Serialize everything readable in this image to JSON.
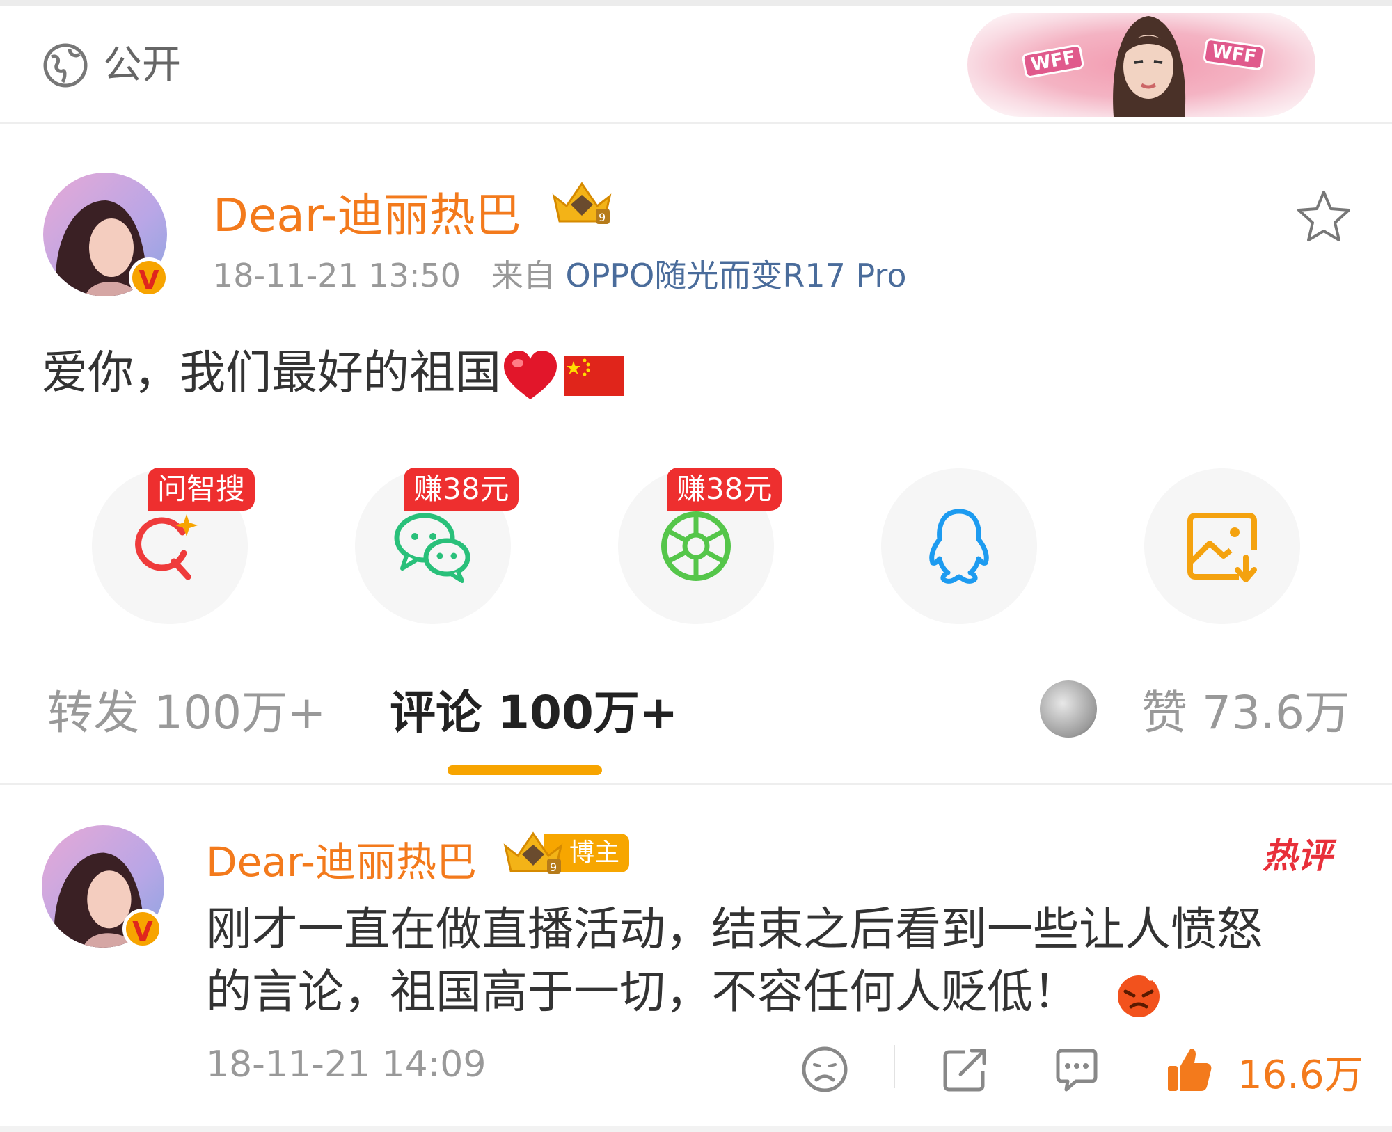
{
  "header": {
    "visibility_label": "公开",
    "banner_tag": "WFF"
  },
  "post": {
    "username": "Dear-迪丽热巴",
    "verified_mark": "V",
    "time": "18-11-21 13:50",
    "source_prefix": "来自",
    "source": "OPPO随光而变R17 Pro",
    "text": "爱你，我们最好的祖国"
  },
  "share": {
    "items": [
      {
        "icon": "ai-search-icon",
        "tag": "问智搜"
      },
      {
        "icon": "wechat-icon",
        "tag": "赚38元"
      },
      {
        "icon": "moments-icon",
        "tag": "赚38元"
      },
      {
        "icon": "qq-icon",
        "tag": ""
      },
      {
        "icon": "save-image-icon",
        "tag": ""
      }
    ]
  },
  "tabs": {
    "repost": "转发 100万+",
    "comment": "评论 100万+",
    "likes": "赞 73.6万",
    "active": "comment"
  },
  "comment": {
    "username": "Dear-迪丽热巴",
    "badge": "博主",
    "hot_label": "热评",
    "line1": "刚才一直在做直播活动，结束之后看到一些让人愤怒",
    "line2": "的言论，祖国高于一切，不容任何人贬低！",
    "time": "18-11-21 14:09",
    "like_count": "16.6万"
  },
  "colors": {
    "brand_orange": "#f37a1c",
    "accent_yellow": "#f7a400",
    "tag_red": "#ee2f2f",
    "source_blue": "#4a6c9b"
  }
}
